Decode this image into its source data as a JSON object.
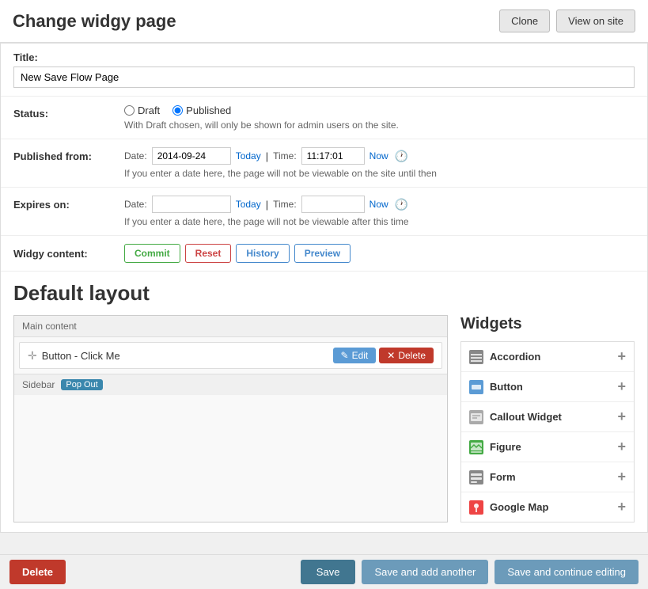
{
  "header": {
    "title": "Change widgy page",
    "clone_label": "Clone",
    "view_on_site_label": "View on site"
  },
  "form": {
    "title_label": "Title:",
    "title_value": "New Save Flow Page",
    "status_label": "Status:",
    "status_draft": "Draft",
    "status_published": "Published",
    "status_hint": "With Draft chosen, will only be shown for admin users on the site.",
    "published_from_label": "Published from:",
    "date_label": "Date:",
    "date_value": "2014-09-24",
    "today_link": "Today",
    "time_label": "Time:",
    "time_value": "11:17:01",
    "now_link": "Now",
    "published_hint": "If you enter a date here, the page will not be viewable on the site until then",
    "expires_label": "Expires on:",
    "expires_date_value": "",
    "expires_time_value": "",
    "expires_hint": "If you enter a date here, the page will not be viewable after this time"
  },
  "widgy": {
    "label": "Widgy content:",
    "commit_btn": "Commit",
    "reset_btn": "Reset",
    "history_btn": "History",
    "preview_btn": "Preview"
  },
  "layout": {
    "title": "Default layout",
    "main_content_label": "Main content",
    "widget_name": "Button - Click Me",
    "edit_btn": "Edit",
    "delete_btn": "Delete",
    "sidebar_label": "Sidebar",
    "pop_out_label": "Pop Out"
  },
  "widgets_panel": {
    "title": "Widgets",
    "items": [
      {
        "name": "Accordion",
        "icon": "accordion"
      },
      {
        "name": "Button",
        "icon": "button"
      },
      {
        "name": "Callout Widget",
        "icon": "callout"
      },
      {
        "name": "Figure",
        "icon": "figure"
      },
      {
        "name": "Form",
        "icon": "form"
      },
      {
        "name": "Google Map",
        "icon": "googlemap"
      }
    ]
  },
  "footer": {
    "delete_label": "Delete",
    "save_label": "Save",
    "save_add_label": "Save and add another",
    "save_continue_label": "Save and continue editing"
  }
}
